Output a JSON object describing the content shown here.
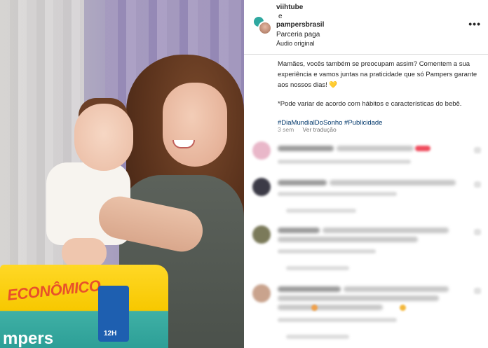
{
  "post": {
    "author_primary": "viihtube",
    "conjunction": "e",
    "author_secondary": "pampersbrasil",
    "paid_label": "Parceria paga",
    "audio_label": "Áudio original",
    "more_icon": "more-horizontal-icon"
  },
  "caption": {
    "paragraph1": "Mamães, vocês também se preocupam assim? Comentem a sua experiência e vamos juntas na praticidade que só Pampers garante aos nossos dias!",
    "heart_emoji": "💛",
    "paragraph2": "*Pode variar de acordo com hábitos e características do bebê.",
    "hashtags": "#DiaMundialDoSonho #Publicidade",
    "time_ago": "3 sem",
    "translate_link": "Ver tradução"
  },
  "media": {
    "pack_text": "ECONÔMICO",
    "pack_brand": "mpers",
    "pack_badge": "12H"
  },
  "colors": {
    "link": "#00376b",
    "muted": "#8e8e8e",
    "pack_yellow": "#ffd826",
    "pack_teal": "#2d9f97"
  }
}
